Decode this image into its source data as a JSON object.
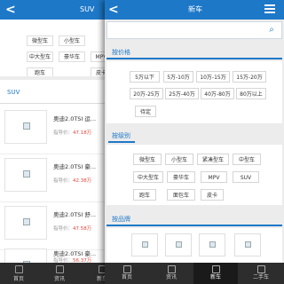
{
  "back_page": {
    "title": "SUV",
    "back_glyph": "<",
    "tags": [
      "微型车",
      "小型车",
      "中大型车",
      "豪华车",
      "MPV",
      "跑车",
      "皮卡"
    ],
    "section_title": "SUV",
    "cars": [
      {
        "name": "奥迪2.0TSI 运...",
        "price_label": "指导价：",
        "price": "47.18万"
      },
      {
        "name": "奥迪2.0TSI 豪...",
        "price_label": "指导价：",
        "price": "42.38万"
      },
      {
        "name": "奥迪2.0TSI 舒...",
        "price_label": "指导价：",
        "price": "47.58万"
      },
      {
        "name": "奥迪2.0TSI 豪...",
        "price_label": "指导价：",
        "price": "56.37万"
      }
    ],
    "tabbar": [
      {
        "label": "首页",
        "icon": "home-icon"
      },
      {
        "label": "资讯",
        "icon": "news-icon"
      },
      {
        "label": "新车",
        "icon": "car-icon"
      }
    ]
  },
  "front_page": {
    "title": "新车",
    "back_glyph": "<",
    "search": {
      "value": "",
      "placeholder": "",
      "icon": "search-icon"
    },
    "price_section": {
      "title": "按价格",
      "options": [
        "5万以下",
        "5万-10万",
        "10万-15万",
        "15万-20万",
        "20万-25万",
        "25万-40万",
        "40万-80万",
        "80万以上",
        "待定"
      ]
    },
    "class_section": {
      "title": "按级别",
      "options": [
        "微型车",
        "小型车",
        "紧凑型车",
        "中型车",
        "中大型车",
        "豪华车",
        "MPV",
        "SUV",
        "跑车",
        "面包车",
        "皮卡"
      ]
    },
    "brand_section": {
      "title": "按品牌",
      "brand_count": 4
    },
    "tabbar": [
      {
        "label": "首页",
        "icon": "home-icon",
        "active": false
      },
      {
        "label": "资讯",
        "icon": "news-icon",
        "active": false
      },
      {
        "label": "新车",
        "icon": "car-icon",
        "active": true
      },
      {
        "label": "二手车",
        "icon": "used-car-icon",
        "active": false
      }
    ]
  },
  "colors": {
    "accent": "#1e78c8",
    "price_red": "#e0463c",
    "tabbar_bg": "#2d2d2d",
    "page_bg": "#ececec"
  }
}
